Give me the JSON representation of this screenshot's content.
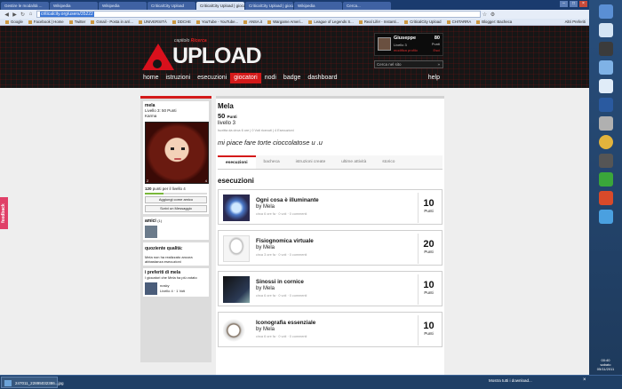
{
  "browser": {
    "tabs": [
      "Gestire le modalità ...",
      "Wikipedia",
      "Wikipedia",
      "CriticalCity Upload",
      "CriticalCity Upload | gioca...",
      "CriticalCity Upload | gioca...",
      "Wikipedia",
      "Cerca..."
    ],
    "active_tab": 4,
    "url": "criticalcity.org/users/35222",
    "bookmarks": [
      "Google",
      "Facebook | Home",
      "Twitter",
      "Gmail - Posta in arri...",
      "UNIVERSITÀ",
      "DDCHE",
      "YouTube - YouTube...",
      "ANSA.it",
      "Wargame Ameri...",
      "League of Legends S...",
      "Real Life! - Instanti...",
      "CriticalCity Upload",
      "CHITARRA",
      "Blogger: Bacheca"
    ],
    "other_bookmarks": "Altri Preferiti"
  },
  "header": {
    "logo_caption": "capitolo",
    "logo_caption_accent": "Ricerca",
    "logo_text": "UPLOAD",
    "user": {
      "name": "Giuseppe",
      "points": "80",
      "points_unit": "Punti",
      "level": "Livello 3",
      "settings": "modifica profilo",
      "logout": "Esci"
    },
    "search_placeholder": "Cerca nel sito",
    "search_go": "»",
    "menu": [
      "home",
      "istruzioni",
      "esecuzioni",
      "giocatori",
      "nodi",
      "badge",
      "dashboard"
    ],
    "menu_active": "giocatori",
    "help": "help"
  },
  "profile_sidebar": {
    "name": "mela",
    "level_line": "Livello 3: 50 Punti",
    "karma": "Karma",
    "portrait_left_num": "2",
    "portrait_right_num": "4",
    "progress_points": "120",
    "progress_text": "punti per il livello 4",
    "progress": 0.3,
    "add_friend": "Aggiungi come amico",
    "write_message": "Scrivi un Messaggio",
    "friends_title": "amici",
    "friends_count": "(1)",
    "quality_title": "quoziente qualità:",
    "quality_text": "Mela non ha realizzato ancora abbastanza esecuzioni",
    "favorites_title": "i preferiti di mela",
    "favorites_sub": "I giocatori che Mela ha più votato",
    "favorite_name": "nosky",
    "favorite_meta": "Livello 4 · 1 Voti"
  },
  "profile_main": {
    "name": "Mela",
    "points": "50",
    "points_unit": "Punti",
    "level": "livello 3",
    "meta": "Iscritta da circa 6 ore | 0 Voti ricevuti | 4 Esecuzioni",
    "quote": "mi piace fare torte cioccolatose u .u",
    "tabs": [
      "esecuzioni",
      "bacheca",
      "istruzioni create",
      "ultime attività",
      "storico"
    ],
    "active_tab": "esecuzioni",
    "section_title": "esecuzioni"
  },
  "executions": [
    {
      "title": "Ogni cosa è illuminante",
      "by": "by Mela",
      "meta": "circa 6 ore fa  ·  0 voti  ·  0 commenti",
      "points": "10",
      "unit": "Punti",
      "thumb": "glowing-sphere"
    },
    {
      "title": "Fisiognomica virtuale",
      "by": "by Mela",
      "meta": "circa 3 ore fa  ·  0 voti  ·  0 commenti",
      "points": "20",
      "unit": "Punti",
      "thumb": "sketch-portrait"
    },
    {
      "title": "Sinossi in cornice",
      "by": "by Mela",
      "meta": "circa 6 ore fa  ·  0 voti  ·  0 commenti",
      "points": "10",
      "unit": "Punti",
      "thumb": "dark-screen"
    },
    {
      "title": "Iconografia essenziale",
      "by": "by Mela",
      "meta": "circa 6 ore fa  ·  0 voti  ·  0 commenti",
      "points": "10",
      "unit": "Punti",
      "thumb": "toy-dog"
    }
  ],
  "feedback": "feedback",
  "taskbar": {
    "item": "247011_22895032386...jpg",
    "downloads": "Mostra tutti i download...",
    "close": "×"
  },
  "clock": {
    "time": "00:40",
    "day": "sabato",
    "date": "05/11/2011"
  },
  "colors": {
    "accent_red": "#d41a1a",
    "header_bg": "#161616",
    "sidebar_green": "#79b839",
    "feedback_pink": "#e04068"
  }
}
